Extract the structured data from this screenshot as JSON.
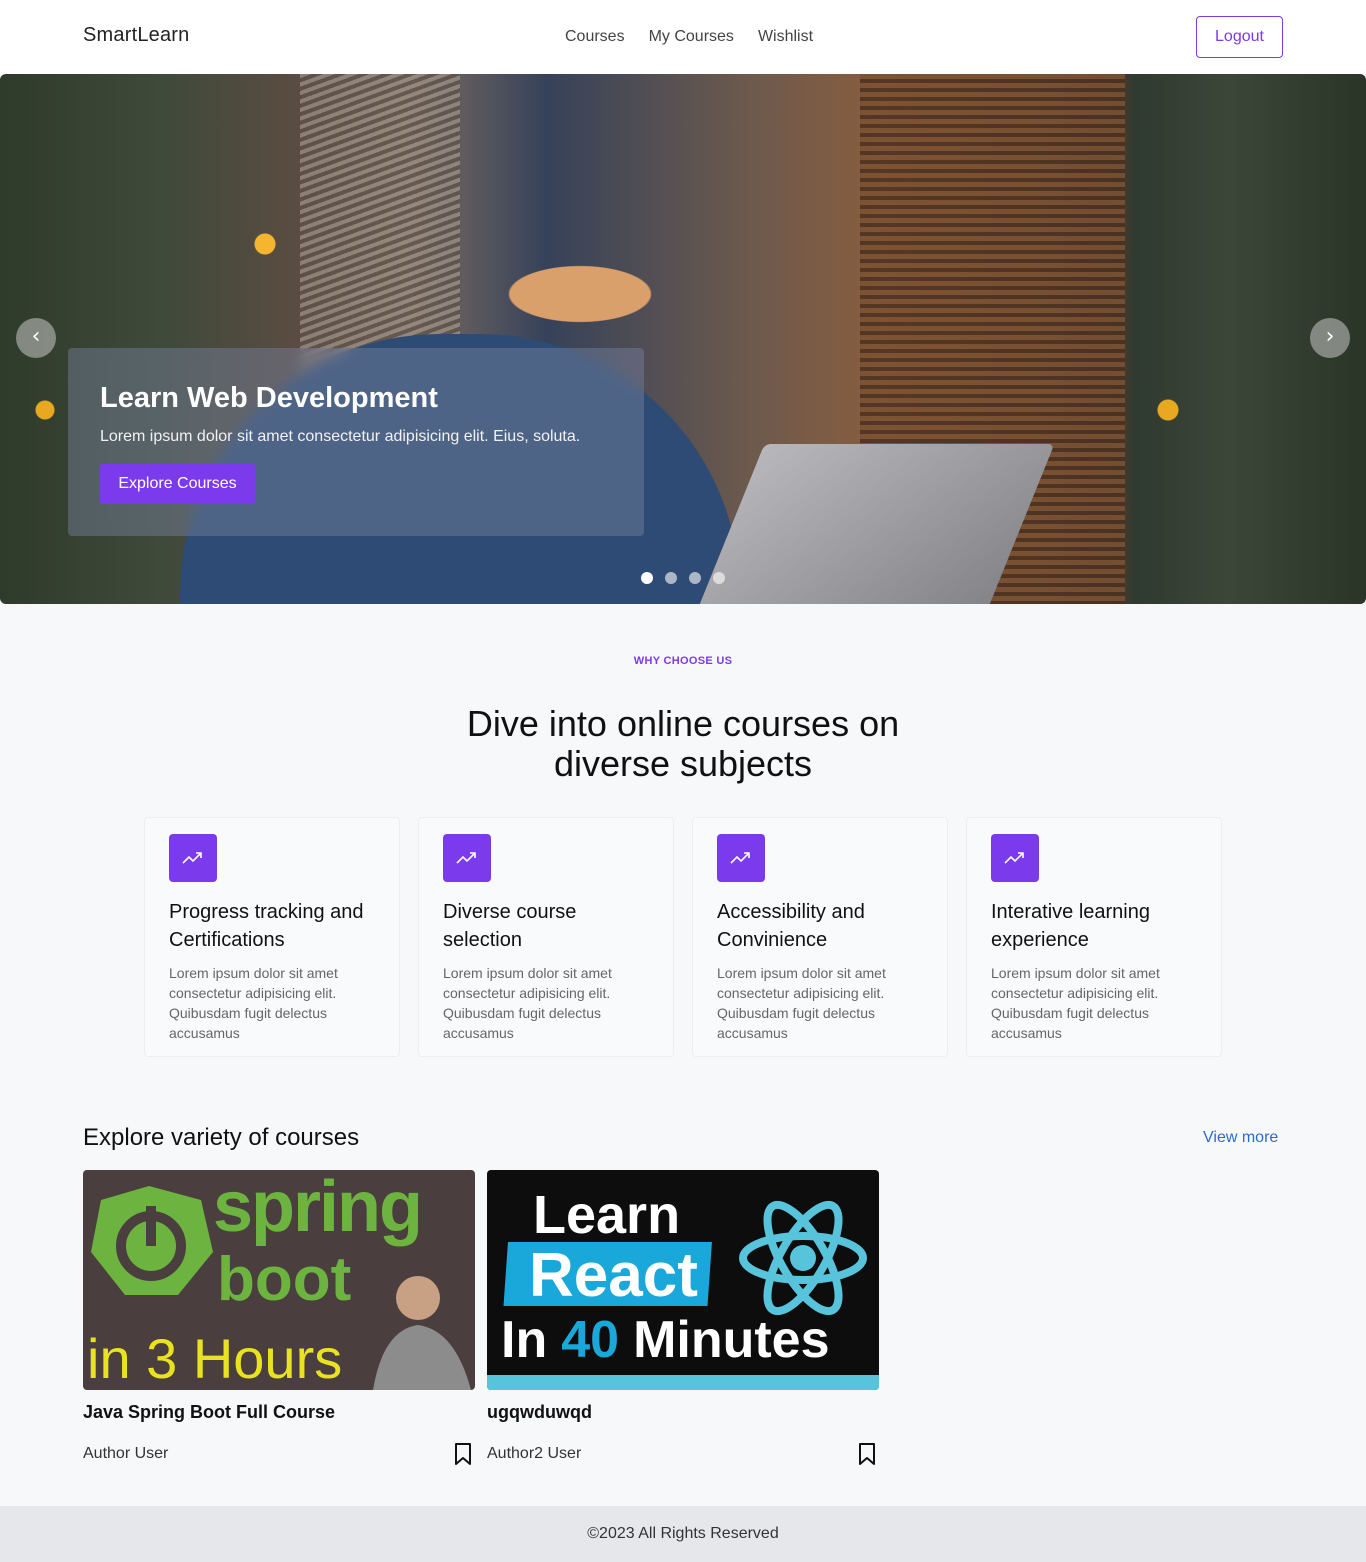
{
  "nav": {
    "brand": "SmartLearn",
    "links": [
      "Courses",
      "My Courses",
      "Wishlist"
    ],
    "logout_label": "Logout"
  },
  "hero": {
    "title": "Learn Web Development",
    "subtitle": "Lorem ipsum dolor sit amet consectetur adipisicing elit. Eius, soluta.",
    "cta_label": "Explore Courses",
    "slide_count": 4,
    "active_slide": 1,
    "prev_icon": "chevron-left-icon",
    "next_icon": "chevron-right-icon"
  },
  "why": {
    "label": "WHY CHOOSE US",
    "title": "Dive into online courses on diverse subjects",
    "features": [
      {
        "title": "Progress tracking and Certifications",
        "desc": "Lorem ipsum dolor sit amet consectetur adipisicing elit. Quibusdam fugit delectus accusamus",
        "icon": "trending-up-icon"
      },
      {
        "title": "Diverse course selection",
        "desc": "Lorem ipsum dolor sit amet consectetur adipisicing elit. Quibusdam fugit delectus accusamus",
        "icon": "trending-up-icon"
      },
      {
        "title": "Accessibility and Convinience",
        "desc": "Lorem ipsum dolor sit amet consectetur adipisicing elit. Quibusdam fugit delectus accusamus",
        "icon": "trending-up-icon"
      },
      {
        "title": "Interative learning experience",
        "desc": "Lorem ipsum dolor sit amet consectetur adipisicing elit. Quibusdam fugit delectus accusamus",
        "icon": "trending-up-icon"
      }
    ]
  },
  "courses": {
    "title": "Explore variety of courses",
    "view_more": "View more",
    "items": [
      {
        "title": "Java Spring Boot Full Course",
        "author": "Author User",
        "thumb_text": [
          "spring",
          "boot",
          "in 3 Hours"
        ],
        "icon": "bookmark-icon"
      },
      {
        "title": "ugqwduwqd",
        "author": "Author2 User",
        "thumb_text": [
          "Learn",
          "React",
          "In",
          "40",
          "Minutes"
        ],
        "icon": "bookmark-icon"
      }
    ]
  },
  "footer": {
    "text": "©2023 All Rights Reserved"
  },
  "colors": {
    "accent": "#7c3aed",
    "link": "#2b6cd1",
    "footer_bg": "#e5e7eb"
  }
}
